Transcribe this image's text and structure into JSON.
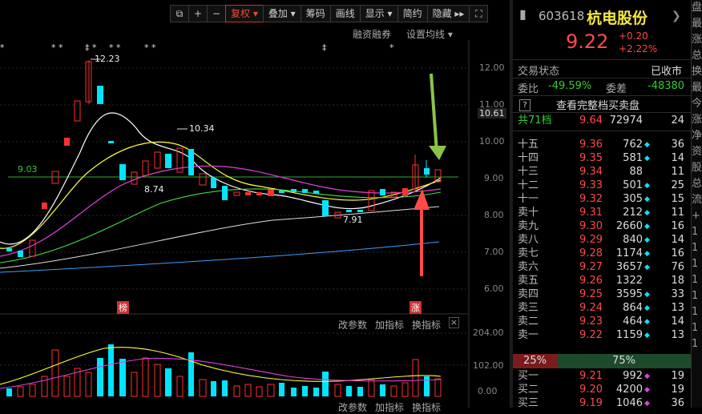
{
  "toolbar": {
    "icon1": "⧉",
    "plus": "+",
    "minus": "−",
    "fuquan": "复权 ▾",
    "diejia": "叠加 ▾",
    "chouma": "筹码",
    "huaxian": "画线",
    "xianshi": "显示 ▾",
    "jianyue": "简约",
    "yincang": "隐藏 ▸▸",
    "expand": "⛶"
  },
  "sublinks": {
    "rongzi": "融资融券",
    "junxian": "设置均线 ▾"
  },
  "price_axis": [
    "12.00",
    "11.00",
    "10.61",
    "10.00",
    "9.00",
    "8.00",
    "7.00",
    "6.00"
  ],
  "vol_axis": [
    "204.00",
    "102.00",
    "0.00"
  ],
  "annotations": {
    "high": "12.23",
    "mid": "10.34",
    "low1": "8.74",
    "low2": "7.91",
    "ref": "9.03",
    "bang": "榜",
    "zhang": "涨"
  },
  "indicator_links": {
    "a": "改参数",
    "b": "加指标",
    "c": "换指标",
    "close": "×"
  },
  "indicator_links2": {
    "a": "改参数",
    "b": "加指标",
    "c": "换指标"
  },
  "markers": [
    "*",
    "* *",
    "‡ *",
    "* *",
    "* *",
    "‡",
    "*"
  ],
  "stock": {
    "code": "603618",
    "name": "杭电股份",
    "price": "9.22",
    "chg": "+0.20",
    "pct": "+2.22%"
  },
  "status": {
    "label": "交易状态",
    "value": "已收市"
  },
  "ratio": {
    "wb_label": "委比",
    "wb": "-49.59%",
    "wc_label": "委差",
    "wc": "-48380"
  },
  "order_book_btn": "查看完整档买卖盘",
  "total": {
    "label": "共71档",
    "price": "9.64",
    "vol": "72974",
    "cnt": "24"
  },
  "asks": [
    {
      "name": "十五",
      "price": "9.36",
      "vol": "762",
      "dot": "cyan",
      "cnt": "36"
    },
    {
      "name": "十四",
      "price": "9.35",
      "vol": "581",
      "dot": "cyan",
      "cnt": "14"
    },
    {
      "name": "十三",
      "price": "9.34",
      "vol": "88",
      "dot": "",
      "cnt": "11"
    },
    {
      "name": "十二",
      "price": "9.33",
      "vol": "501",
      "dot": "cyan",
      "cnt": "25"
    },
    {
      "name": "十一",
      "price": "9.32",
      "vol": "305",
      "dot": "cyan",
      "cnt": "15"
    },
    {
      "name": "卖十",
      "price": "9.31",
      "vol": "212",
      "dot": "cyan",
      "cnt": "11"
    },
    {
      "name": "卖九",
      "price": "9.30",
      "vol": "2660",
      "dot": "cyan",
      "cnt": "16"
    },
    {
      "name": "卖八",
      "price": "9.29",
      "vol": "840",
      "dot": "cyan",
      "cnt": "14"
    },
    {
      "name": "卖七",
      "price": "9.28",
      "vol": "1174",
      "dot": "cyan",
      "cnt": "16"
    },
    {
      "name": "卖六",
      "price": "9.27",
      "vol": "3657",
      "dot": "cyan",
      "cnt": "76"
    },
    {
      "name": "卖五",
      "price": "9.26",
      "vol": "1322",
      "dot": "",
      "cnt": "18"
    },
    {
      "name": "卖四",
      "price": "9.25",
      "vol": "3595",
      "dot": "cyan",
      "cnt": "33"
    },
    {
      "name": "卖三",
      "price": "9.24",
      "vol": "864",
      "dot": "cyan",
      "cnt": "13"
    },
    {
      "name": "卖二",
      "price": "9.23",
      "vol": "464",
      "dot": "cyan",
      "cnt": "14"
    },
    {
      "name": "卖一",
      "price": "9.22",
      "vol": "1159",
      "dot": "cyan",
      "cnt": "13"
    }
  ],
  "bar": {
    "left": "25%",
    "right": "75%"
  },
  "bids": [
    {
      "name": "买一",
      "price": "9.21",
      "vol": "992",
      "dot": "magenta",
      "cnt": "19"
    },
    {
      "name": "买二",
      "price": "9.20",
      "vol": "4200",
      "dot": "magenta",
      "cnt": "19"
    },
    {
      "name": "买三",
      "price": "9.19",
      "vol": "1046",
      "dot": "magenta",
      "cnt": "36"
    }
  ],
  "side_tabs": [
    "盘",
    "最",
    "涨",
    "总",
    "换",
    "最",
    "今",
    "涨",
    "净",
    "资",
    "股",
    "总",
    "流",
    "+",
    "1",
    "1",
    "1",
    "1",
    "1",
    "1",
    "1",
    "1"
  ]
}
